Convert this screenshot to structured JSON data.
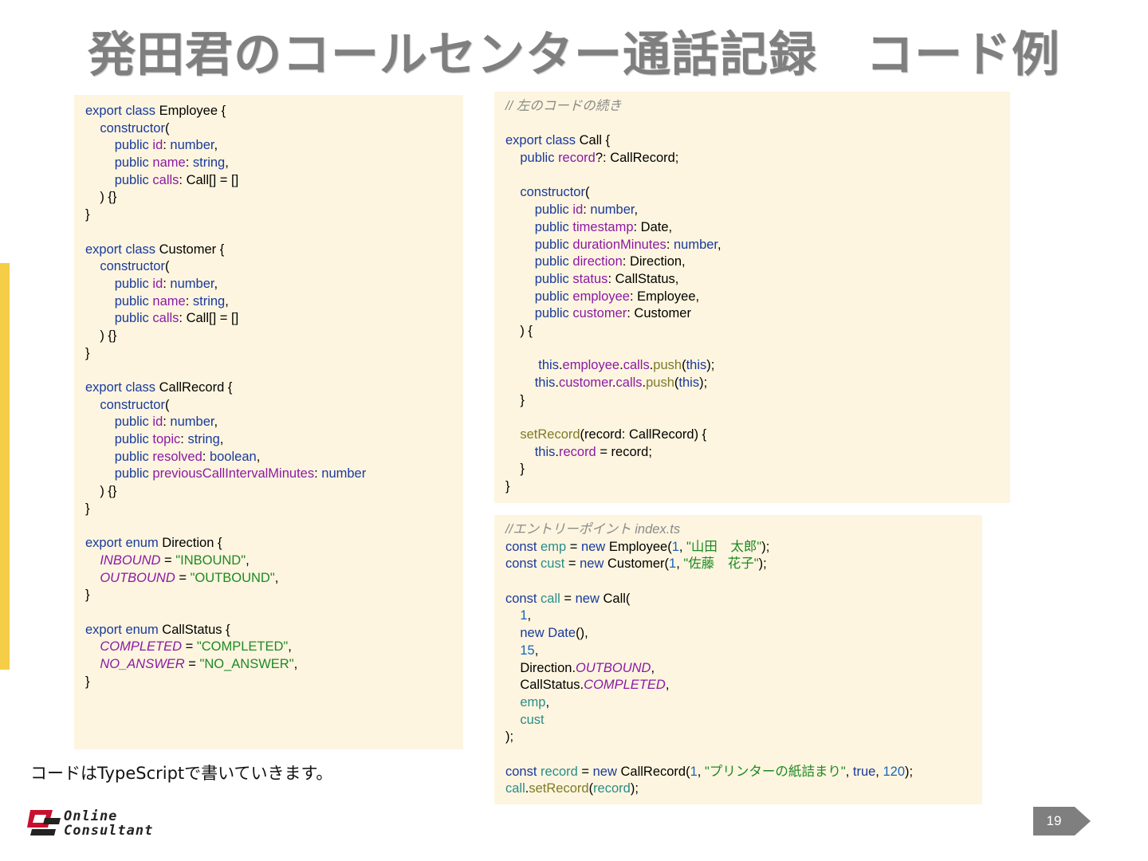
{
  "title": "発田君のコールセンター通話記録　コード例",
  "caption": "コードはTypeScriptで書いていきます。",
  "page_number": "19",
  "logo": {
    "line1": "Online",
    "line2": "Consultant"
  },
  "colors": {
    "accent_bar": "#f5cd47",
    "code_bg": "#fdf5df",
    "keyword": "#1a3a9c",
    "property": "#8b1aa6",
    "string": "#1d8a24"
  },
  "code_left": [
    [
      [
        "kw",
        "export class"
      ],
      [
        "t",
        " Employee {"
      ]
    ],
    [
      [
        "t",
        "    "
      ],
      [
        "kw",
        "constructor"
      ],
      [
        "t",
        "("
      ]
    ],
    [
      [
        "t",
        "        "
      ],
      [
        "kw",
        "public"
      ],
      [
        "t",
        " "
      ],
      [
        "prop",
        "id"
      ],
      [
        "t",
        ": "
      ],
      [
        "kw",
        "number"
      ],
      [
        "t",
        ","
      ]
    ],
    [
      [
        "t",
        "        "
      ],
      [
        "kw",
        "public"
      ],
      [
        "t",
        " "
      ],
      [
        "prop",
        "name"
      ],
      [
        "t",
        ": "
      ],
      [
        "kw",
        "string"
      ],
      [
        "t",
        ","
      ]
    ],
    [
      [
        "t",
        "        "
      ],
      [
        "kw",
        "public"
      ],
      [
        "t",
        " "
      ],
      [
        "prop",
        "calls"
      ],
      [
        "t",
        ": Call[] = []"
      ]
    ],
    [
      [
        "t",
        "    ) {}"
      ]
    ],
    [
      [
        "t",
        "}"
      ]
    ],
    [],
    [
      [
        "kw",
        "export class"
      ],
      [
        "t",
        " Customer {"
      ]
    ],
    [
      [
        "t",
        "    "
      ],
      [
        "kw",
        "constructor"
      ],
      [
        "t",
        "("
      ]
    ],
    [
      [
        "t",
        "        "
      ],
      [
        "kw",
        "public"
      ],
      [
        "t",
        " "
      ],
      [
        "prop",
        "id"
      ],
      [
        "t",
        ": "
      ],
      [
        "kw",
        "number"
      ],
      [
        "t",
        ","
      ]
    ],
    [
      [
        "t",
        "        "
      ],
      [
        "kw",
        "public"
      ],
      [
        "t",
        " "
      ],
      [
        "prop",
        "name"
      ],
      [
        "t",
        ": "
      ],
      [
        "kw",
        "string"
      ],
      [
        "t",
        ","
      ]
    ],
    [
      [
        "t",
        "        "
      ],
      [
        "kw",
        "public"
      ],
      [
        "t",
        " "
      ],
      [
        "prop",
        "calls"
      ],
      [
        "t",
        ": Call[] = []"
      ]
    ],
    [
      [
        "t",
        "    ) {}"
      ]
    ],
    [
      [
        "t",
        "}"
      ]
    ],
    [],
    [
      [
        "kw",
        "export class"
      ],
      [
        "t",
        " CallRecord {"
      ]
    ],
    [
      [
        "t",
        "    "
      ],
      [
        "kw",
        "constructor"
      ],
      [
        "t",
        "("
      ]
    ],
    [
      [
        "t",
        "        "
      ],
      [
        "kw",
        "public"
      ],
      [
        "t",
        " "
      ],
      [
        "prop",
        "id"
      ],
      [
        "t",
        ": "
      ],
      [
        "kw",
        "number"
      ],
      [
        "t",
        ","
      ]
    ],
    [
      [
        "t",
        "        "
      ],
      [
        "kw",
        "public"
      ],
      [
        "t",
        " "
      ],
      [
        "prop",
        "topic"
      ],
      [
        "t",
        ": "
      ],
      [
        "kw",
        "string"
      ],
      [
        "t",
        ","
      ]
    ],
    [
      [
        "t",
        "        "
      ],
      [
        "kw",
        "public"
      ],
      [
        "t",
        " "
      ],
      [
        "prop",
        "resolved"
      ],
      [
        "t",
        ": "
      ],
      [
        "kw",
        "boolean"
      ],
      [
        "t",
        ","
      ]
    ],
    [
      [
        "t",
        "        "
      ],
      [
        "kw",
        "public"
      ],
      [
        "t",
        " "
      ],
      [
        "prop",
        "previousCallIntervalMinutes"
      ],
      [
        "t",
        ": "
      ],
      [
        "kw",
        "number"
      ]
    ],
    [
      [
        "t",
        "    ) {}"
      ]
    ],
    [
      [
        "t",
        "}"
      ]
    ],
    [],
    [
      [
        "kw",
        "export enum"
      ],
      [
        "t",
        " Direction {"
      ]
    ],
    [
      [
        "t",
        "    "
      ],
      [
        "enm",
        "INBOUND"
      ],
      [
        "t",
        " = "
      ],
      [
        "str",
        "\"INBOUND\""
      ],
      [
        "t",
        ","
      ]
    ],
    [
      [
        "t",
        "    "
      ],
      [
        "enm",
        "OUTBOUND"
      ],
      [
        "t",
        " = "
      ],
      [
        "str",
        "\"OUTBOUND\""
      ],
      [
        "t",
        ","
      ]
    ],
    [
      [
        "t",
        "}"
      ]
    ],
    [],
    [
      [
        "kw",
        "export enum"
      ],
      [
        "t",
        " CallStatus {"
      ]
    ],
    [
      [
        "t",
        "    "
      ],
      [
        "enm",
        "COMPLETED"
      ],
      [
        "t",
        " = "
      ],
      [
        "str",
        "\"COMPLETED\""
      ],
      [
        "t",
        ","
      ]
    ],
    [
      [
        "t",
        "    "
      ],
      [
        "enm",
        "NO_ANSWER"
      ],
      [
        "t",
        " = "
      ],
      [
        "str",
        "\"NO_ANSWER\""
      ],
      [
        "t",
        ","
      ]
    ],
    [
      [
        "t",
        "}"
      ]
    ]
  ],
  "code_right_top": [
    [
      [
        "cmt",
        "// 左のコードの続き"
      ]
    ],
    [],
    [
      [
        "kw",
        "export class"
      ],
      [
        "t",
        " Call {"
      ]
    ],
    [
      [
        "t",
        "    "
      ],
      [
        "kw",
        "public"
      ],
      [
        "t",
        " "
      ],
      [
        "prop",
        "record"
      ],
      [
        "t",
        "?: CallRecord;"
      ]
    ],
    [],
    [
      [
        "t",
        "    "
      ],
      [
        "kw",
        "constructor"
      ],
      [
        "t",
        "("
      ]
    ],
    [
      [
        "t",
        "        "
      ],
      [
        "kw",
        "public"
      ],
      [
        "t",
        " "
      ],
      [
        "prop",
        "id"
      ],
      [
        "t",
        ": "
      ],
      [
        "kw",
        "number"
      ],
      [
        "t",
        ","
      ]
    ],
    [
      [
        "t",
        "        "
      ],
      [
        "kw",
        "public"
      ],
      [
        "t",
        " "
      ],
      [
        "prop",
        "timestamp"
      ],
      [
        "t",
        ": Date,"
      ]
    ],
    [
      [
        "t",
        "        "
      ],
      [
        "kw",
        "public"
      ],
      [
        "t",
        " "
      ],
      [
        "prop",
        "durationMinutes"
      ],
      [
        "t",
        ": "
      ],
      [
        "kw",
        "number"
      ],
      [
        "t",
        ","
      ]
    ],
    [
      [
        "t",
        "        "
      ],
      [
        "kw",
        "public"
      ],
      [
        "t",
        " "
      ],
      [
        "prop",
        "direction"
      ],
      [
        "t",
        ": Direction,"
      ]
    ],
    [
      [
        "t",
        "        "
      ],
      [
        "kw",
        "public"
      ],
      [
        "t",
        " "
      ],
      [
        "prop",
        "status"
      ],
      [
        "t",
        ": CallStatus,"
      ]
    ],
    [
      [
        "t",
        "        "
      ],
      [
        "kw",
        "public"
      ],
      [
        "t",
        " "
      ],
      [
        "prop",
        "employee"
      ],
      [
        "t",
        ": Employee,"
      ]
    ],
    [
      [
        "t",
        "        "
      ],
      [
        "kw",
        "public"
      ],
      [
        "t",
        " "
      ],
      [
        "prop",
        "customer"
      ],
      [
        "t",
        ": Customer"
      ]
    ],
    [
      [
        "t",
        "    ) {"
      ]
    ],
    [],
    [
      [
        "t",
        "         "
      ],
      [
        "kw",
        "this"
      ],
      [
        "t",
        "."
      ],
      [
        "prop",
        "employee"
      ],
      [
        "t",
        "."
      ],
      [
        "prop",
        "calls"
      ],
      [
        "t",
        "."
      ],
      [
        "fn",
        "push"
      ],
      [
        "t",
        "("
      ],
      [
        "kw",
        "this"
      ],
      [
        "t",
        ");"
      ]
    ],
    [
      [
        "t",
        "        "
      ],
      [
        "kw",
        "this"
      ],
      [
        "t",
        "."
      ],
      [
        "prop",
        "customer"
      ],
      [
        "t",
        "."
      ],
      [
        "prop",
        "calls"
      ],
      [
        "t",
        "."
      ],
      [
        "fn",
        "push"
      ],
      [
        "t",
        "("
      ],
      [
        "kw",
        "this"
      ],
      [
        "t",
        ");"
      ]
    ],
    [
      [
        "t",
        "    }"
      ]
    ],
    [],
    [
      [
        "t",
        "    "
      ],
      [
        "fn",
        "setRecord"
      ],
      [
        "t",
        "(record: CallRecord) {"
      ]
    ],
    [
      [
        "t",
        "        "
      ],
      [
        "kw",
        "this"
      ],
      [
        "t",
        "."
      ],
      [
        "prop",
        "record"
      ],
      [
        "t",
        " = record;"
      ]
    ],
    [
      [
        "t",
        "    }"
      ]
    ],
    [
      [
        "t",
        "}"
      ]
    ]
  ],
  "code_right_bottom": [
    [
      [
        "cmt",
        "//エントリーポイント index.ts"
      ]
    ],
    [
      [
        "kw",
        "const"
      ],
      [
        "t",
        " "
      ],
      [
        "var",
        "emp"
      ],
      [
        "t",
        " = "
      ],
      [
        "kw",
        "new"
      ],
      [
        "t",
        " Employee("
      ],
      [
        "num",
        "1"
      ],
      [
        "t",
        ", "
      ],
      [
        "str",
        "\"山田　太郎\""
      ],
      [
        "t",
        ");"
      ]
    ],
    [
      [
        "kw",
        "const"
      ],
      [
        "t",
        " "
      ],
      [
        "var",
        "cust"
      ],
      [
        "t",
        " = "
      ],
      [
        "kw",
        "new"
      ],
      [
        "t",
        " Customer("
      ],
      [
        "num",
        "1"
      ],
      [
        "t",
        ", "
      ],
      [
        "str",
        "\"佐藤　花子\""
      ],
      [
        "t",
        ");"
      ]
    ],
    [],
    [
      [
        "kw",
        "const"
      ],
      [
        "t",
        " "
      ],
      [
        "var",
        "call"
      ],
      [
        "t",
        " = "
      ],
      [
        "kw",
        "new"
      ],
      [
        "t",
        " Call("
      ]
    ],
    [
      [
        "t",
        "    "
      ],
      [
        "num",
        "1"
      ],
      [
        "t",
        ","
      ]
    ],
    [
      [
        "t",
        "    "
      ],
      [
        "kw",
        "new"
      ],
      [
        "t",
        " "
      ],
      [
        "kw",
        "Date"
      ],
      [
        "t",
        "(),"
      ]
    ],
    [
      [
        "t",
        "    "
      ],
      [
        "num",
        "15"
      ],
      [
        "t",
        ","
      ]
    ],
    [
      [
        "t",
        "    Direction."
      ],
      [
        "enm",
        "OUTBOUND"
      ],
      [
        "t",
        ","
      ]
    ],
    [
      [
        "t",
        "    CallStatus."
      ],
      [
        "enm",
        "COMPLETED"
      ],
      [
        "t",
        ","
      ]
    ],
    [
      [
        "t",
        "    "
      ],
      [
        "var",
        "emp"
      ],
      [
        "t",
        ","
      ]
    ],
    [
      [
        "t",
        "    "
      ],
      [
        "var",
        "cust"
      ]
    ],
    [
      [
        "t",
        ");"
      ]
    ],
    [],
    [
      [
        "kw",
        "const"
      ],
      [
        "t",
        " "
      ],
      [
        "var",
        "record"
      ],
      [
        "t",
        " = "
      ],
      [
        "kw",
        "new"
      ],
      [
        "t",
        " CallRecord("
      ],
      [
        "num",
        "1"
      ],
      [
        "t",
        ", "
      ],
      [
        "str",
        "\"プリンターの紙詰まり\""
      ],
      [
        "t",
        ", "
      ],
      [
        "kw",
        "true"
      ],
      [
        "t",
        ", "
      ],
      [
        "num",
        "120"
      ],
      [
        "t",
        ");"
      ]
    ],
    [
      [
        "var",
        "call"
      ],
      [
        "t",
        "."
      ],
      [
        "fn",
        "setRecord"
      ],
      [
        "t",
        "("
      ],
      [
        "var",
        "record"
      ],
      [
        "t",
        ");"
      ]
    ]
  ]
}
